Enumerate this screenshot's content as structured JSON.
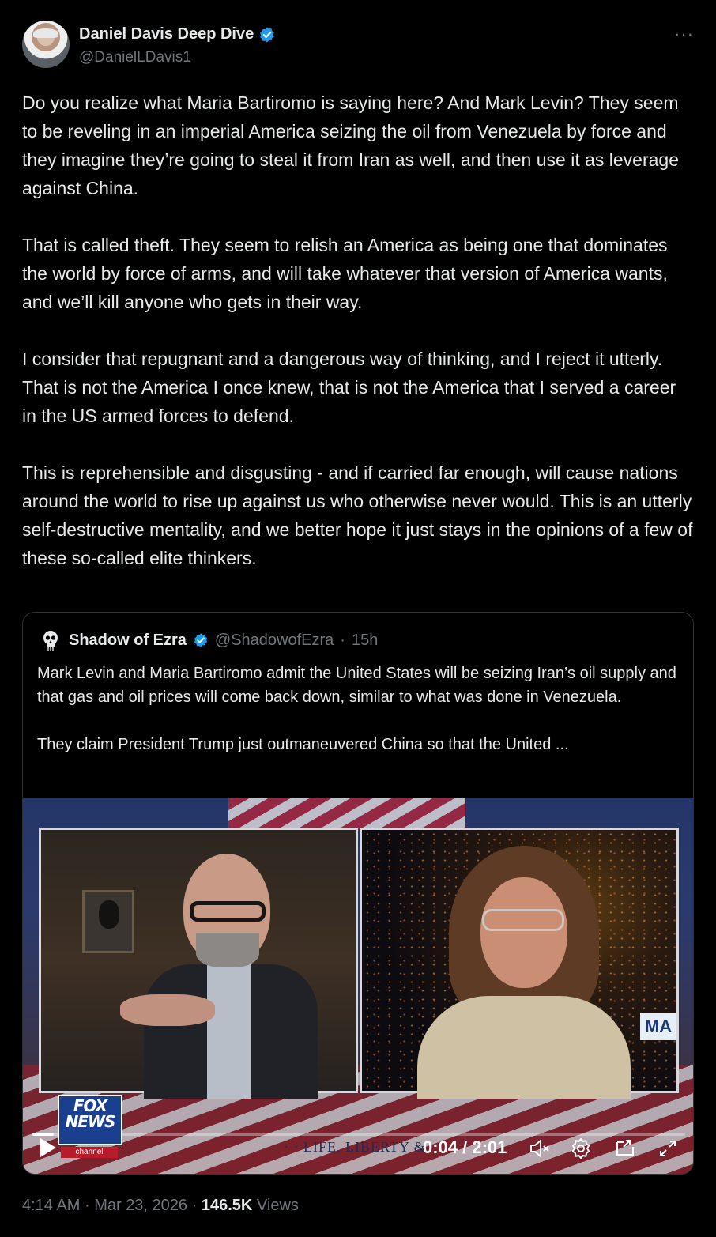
{
  "author": {
    "display_name": "Daniel Davis Deep Dive",
    "handle": "@DanielLDavis1",
    "verified": true,
    "more_label": "···"
  },
  "tweet": {
    "paragraphs": [
      "Do you realize what Maria Bartiromo is saying here? And Mark Levin? They seem to be reveling in an imperial America seizing the oil from Venezuela by force and they imagine they’re going to steal it from Iran as well, and then use it as leverage against China.",
      "That is called theft. They seem to relish an America as being one that dominates the world by force of arms, and will take whatever that version of America wants, and we’ll kill anyone who gets in their way.",
      "I consider that repugnant and a dangerous way of thinking, and I reject it utterly. That is not the America I once knew, that is not the America that I served a career in the US armed forces to defend.",
      "This is reprehensible and disgusting - and if carried far enough, will cause nations around the world to rise up against us who otherwise never would. This is an utterly self-destructive mentality, and we better hope it just stays in the opinions of a few of these so-called elite thinkers."
    ]
  },
  "quote": {
    "display_name": "Shadow of Ezra",
    "handle": "@ShadowofEzra",
    "separator": "·",
    "time": "15h",
    "paragraphs": [
      "Mark Levin and Maria Bartiromo admit the United States will be seizing Iran’s oil supply and that gas and oil prices will come back down, similar to what was done in Venezuela.",
      "They claim President Trump just outmaneuvered China so that the United ..."
    ]
  },
  "video": {
    "time_display": "0:04 / 2:01",
    "progress_fraction": 0.033,
    "logo_line1": "FOX",
    "logo_line2": "NEWS",
    "logo_line3": "channel",
    "lower_third": "· · LIFE, LIBERTY &",
    "side_sign": "MA",
    "icons": [
      "play-icon",
      "mute-icon",
      "settings-icon",
      "pip-icon",
      "fullscreen-icon"
    ]
  },
  "footer": {
    "time": "4:14 AM",
    "date": "Mar 23, 2026",
    "separator": "·",
    "views_count": "146.5K",
    "views_label": "Views"
  },
  "colors": {
    "background": "#000000",
    "text": "#e7e9ea",
    "secondary": "#71767b",
    "verified": "#1d9bf0",
    "border": "#2f3336"
  }
}
